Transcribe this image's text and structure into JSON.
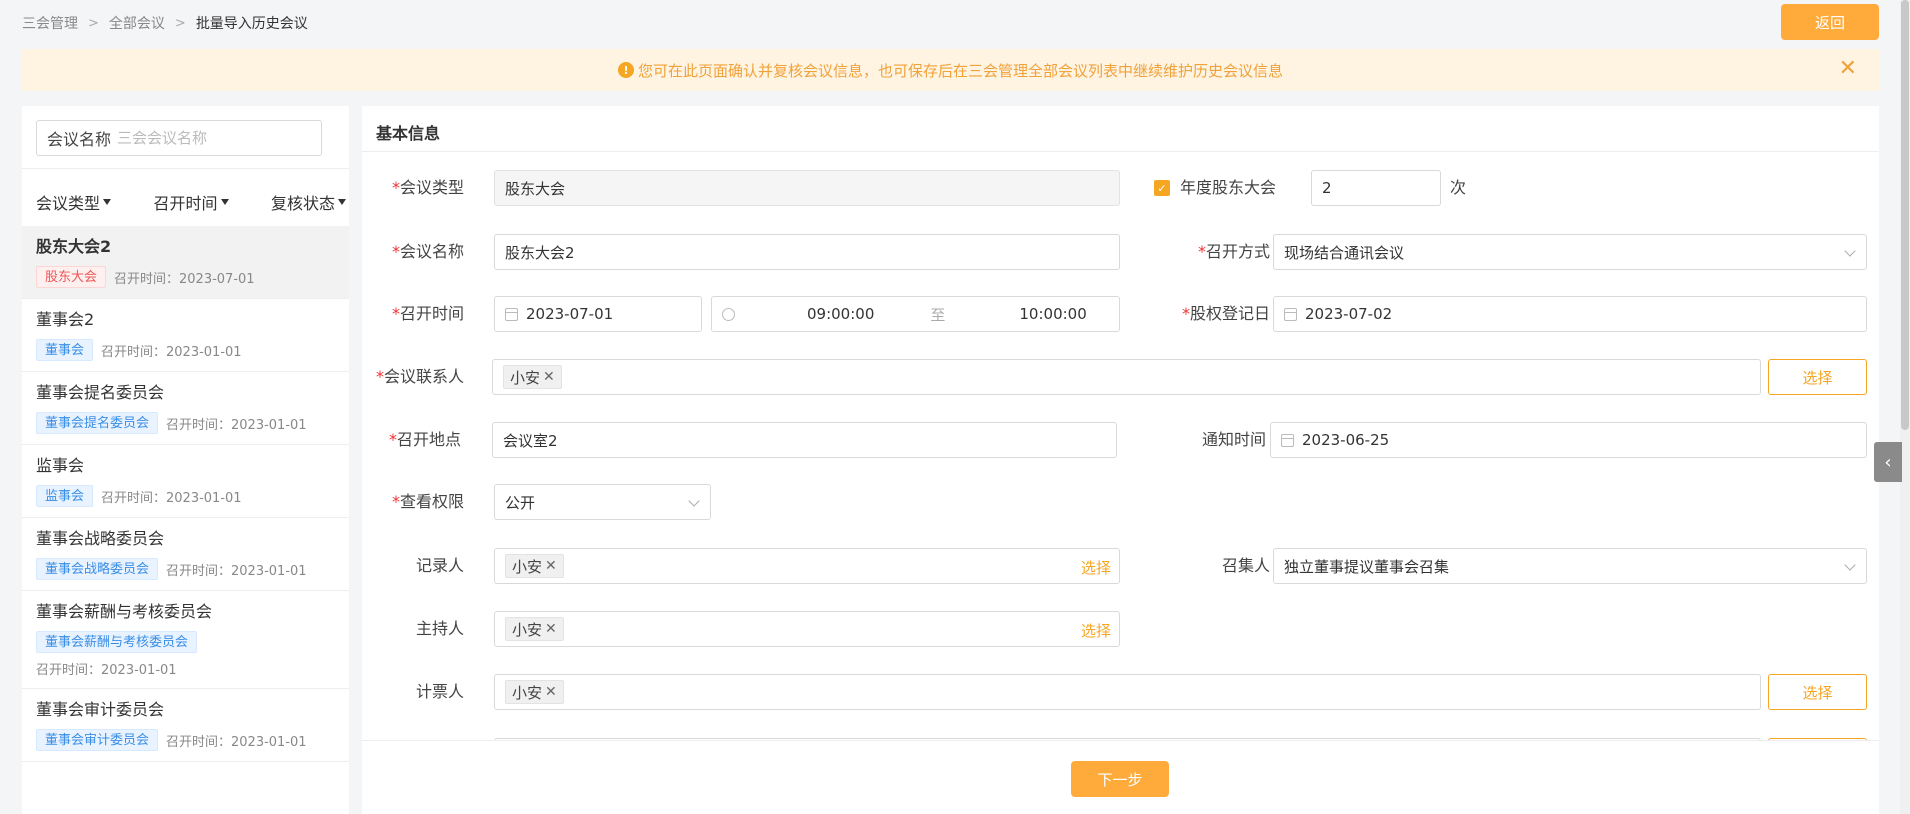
{
  "breadcrumb": {
    "items": [
      "三会管理",
      "全部会议"
    ],
    "current": "批量导入历史会议"
  },
  "header": {
    "back_label": "返回"
  },
  "notice": {
    "text": "您可在此页面确认并复核会议信息，也可保存后在三会管理全部会议列表中继续维护历史会议信息",
    "close": "✕"
  },
  "sidebar": {
    "search_label": "会议名称",
    "search_placeholder": "三会会议名称",
    "filters": [
      "会议类型",
      "召开时间",
      "复核状态"
    ],
    "items": [
      {
        "name": "股东大会2",
        "tag": "股东大会",
        "time": "召开时间：2023-07-01"
      },
      {
        "name": "董事会2",
        "tag": "董事会",
        "time": "召开时间：2023-01-01"
      },
      {
        "name": "董事会提名委员会",
        "tag": "董事会提名委员会",
        "time": "召开时间：2023-01-01"
      },
      {
        "name": "监事会",
        "tag": "监事会",
        "time": "召开时间：2023-01-01"
      },
      {
        "name": "董事会战略委员会",
        "tag": "董事会战略委员会",
        "time": "召开时间：2023-01-01"
      },
      {
        "name": "董事会薪酬与考核委员会",
        "tag": "董事会薪酬与考核委员会",
        "time": "召开时间：2023-01-01"
      },
      {
        "name": "董事会审计委员会",
        "tag": "董事会审计委员会",
        "time": "召开时间：2023-01-01"
      }
    ]
  },
  "form": {
    "section_title": "基本信息",
    "meeting_type": {
      "label": "会议类型",
      "value": "股东大会"
    },
    "annual": {
      "label": "年度股东大会",
      "count": "2",
      "unit": "次"
    },
    "meeting_name": {
      "label": "会议名称",
      "value": "股东大会2"
    },
    "mode": {
      "label": "召开方式",
      "value": "现场结合通讯会议"
    },
    "time": {
      "label": "召开时间",
      "date": "2023-07-01",
      "start": "09:00:00",
      "to": "至",
      "end": "10:00:00"
    },
    "record_date": {
      "label": "股权登记日",
      "value": "2023-07-02"
    },
    "contact": {
      "label": "会议联系人",
      "chip": "小安",
      "pick": "选择"
    },
    "location": {
      "label": "召开地点",
      "value": "会议室2"
    },
    "notice_time": {
      "label": "通知时间",
      "value": "2023-06-25"
    },
    "permission": {
      "label": "查看权限",
      "value": "公开"
    },
    "recorder": {
      "label": "记录人",
      "chip": "小安",
      "pick": "选择"
    },
    "convener": {
      "label": "召集人",
      "value": "独立董事提议董事会召集"
    },
    "host": {
      "label": "主持人",
      "chip": "小安",
      "pick": "选择"
    },
    "teller": {
      "label": "计票人",
      "chip": "小安",
      "pick": "选择"
    }
  },
  "footer": {
    "next_label": "下一步"
  },
  "colors": {
    "accent": "#ffab3c",
    "notice_bg": "#fff3e2",
    "tag_blue": "#3a8ee6",
    "tag_red": "#e55555"
  }
}
